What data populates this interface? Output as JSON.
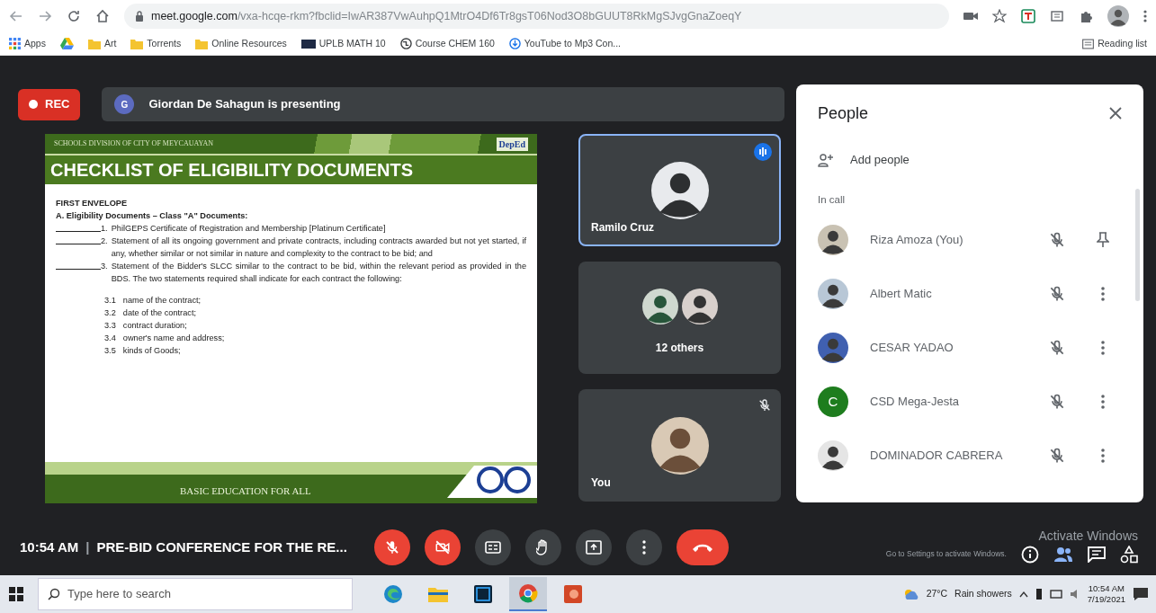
{
  "browser": {
    "url_host": "meet.google.com",
    "url_path": "/vxa-hcqe-rkm?fbclid=IwAR387VwAuhpQ1MtrO4Df6Tr8gsT06Nod3O8bGUUT8RkMgSJvgGnaZoeqY",
    "bookmarks": [
      {
        "kind": "apps",
        "label": "Apps"
      },
      {
        "kind": "drive"
      },
      {
        "kind": "folder",
        "label": "Art"
      },
      {
        "kind": "folder",
        "label": "Torrents"
      },
      {
        "kind": "folder",
        "label": "Online Resources"
      },
      {
        "kind": "page",
        "label": "UPLB MATH 10"
      },
      {
        "kind": "globe",
        "label": "Course CHEM 160"
      },
      {
        "kind": "info",
        "label": "YouTube to Mp3 Con..."
      }
    ],
    "reading_list": "Reading list"
  },
  "meeting": {
    "rec": "REC",
    "presenter_initial": "G",
    "presenting": "Giordan De Sahagun is presenting",
    "slide": {
      "division": "SCHOOLS DIVISION OF CITY OF MEYCAUAYAN",
      "logo": "DepEd",
      "title": "CHECKLIST OF ELIGIBILITY DOCUMENTS",
      "heading": "FIRST ENVELOPE",
      "section": "A.  Eligibility Documents – Class \"A\" Documents:",
      "items": [
        {
          "number": "1.",
          "text": "PhilGEPS Certificate of Registration and Membership [Platinum Certificate]"
        },
        {
          "number": "2.",
          "text": "Statement of all its ongoing government and private contracts, including contracts awarded but not yet started, if any, whether similar or not similar in nature and complexity to the contract to be bid; and"
        },
        {
          "number": "3.",
          "text": "Statement of the Bidder's SLCC similar to the contract to be bid, within the relevant period as provided in the BDS. The two statements required shall indicate for each contract the following:"
        }
      ],
      "subitems": [
        {
          "number": "3.1",
          "text": "name of the contract;"
        },
        {
          "number": "3.2",
          "text": "date of the contract;"
        },
        {
          "number": "3.3",
          "text": "contract duration;"
        },
        {
          "number": "3.4",
          "text": "owner's name and address;"
        },
        {
          "number": "3.5",
          "text": "kinds of Goods;"
        }
      ],
      "footer": "BASIC EDUCATION FOR ALL"
    },
    "tiles": [
      {
        "kind": "speaker",
        "name": "Ramilo Cruz",
        "speaking": true
      },
      {
        "kind": "group",
        "name": "12 others"
      },
      {
        "kind": "self",
        "name": "You",
        "muted": true
      }
    ],
    "people": {
      "title": "People",
      "add": "Add people",
      "section": "In call",
      "rows": [
        {
          "name": "Riza Amoza (You)",
          "avatar": {
            "kind": "photo"
          },
          "muted": true,
          "action": {
            "kind": "pin"
          }
        },
        {
          "name": "Albert Matic",
          "avatar": {
            "kind": "photo"
          },
          "muted": true,
          "action": {
            "kind": "more"
          }
        },
        {
          "name": "CESAR YADAO",
          "avatar": {
            "kind": "photo"
          },
          "muted": true,
          "action": {
            "kind": "more"
          }
        },
        {
          "name": "CSD Mega-Jesta",
          "avatar": {
            "kind": "letter",
            "initial": "C"
          },
          "muted": true,
          "action": {
            "kind": "more"
          }
        },
        {
          "name": "DOMINADOR CABRERA",
          "avatar": {
            "kind": "photo"
          },
          "muted": true,
          "action": {
            "kind": "more"
          }
        }
      ]
    },
    "bottom": {
      "time": "10:54 AM",
      "separator": "|",
      "title": "PRE-BID CONFERENCE FOR THE RE...",
      "controls": [
        {
          "kind": "mic",
          "on": false
        },
        {
          "kind": "camera",
          "on": false
        },
        {
          "kind": "captions"
        },
        {
          "kind": "hand"
        },
        {
          "kind": "present"
        },
        {
          "kind": "more"
        },
        {
          "kind": "leave"
        }
      ],
      "side": [
        {
          "kind": "info"
        },
        {
          "kind": "people"
        },
        {
          "kind": "chat"
        },
        {
          "kind": "activities"
        }
      ]
    }
  },
  "activation": {
    "title": "Activate Windows",
    "hint": "Go to Settings to activate Windows."
  },
  "taskbar": {
    "search_placeholder": "Type here to search",
    "apps": [
      {
        "kind": "edge",
        "selected": false
      },
      {
        "kind": "explorer",
        "selected": false
      },
      {
        "kind": "photoshop",
        "selected": false
      },
      {
        "kind": "chrome",
        "selected": true
      },
      {
        "kind": "powerpoint",
        "selected": false
      }
    ],
    "temperature": "27°C",
    "weather": "Rain showers",
    "time": "10:54 AM",
    "date": "7/19/2021"
  }
}
